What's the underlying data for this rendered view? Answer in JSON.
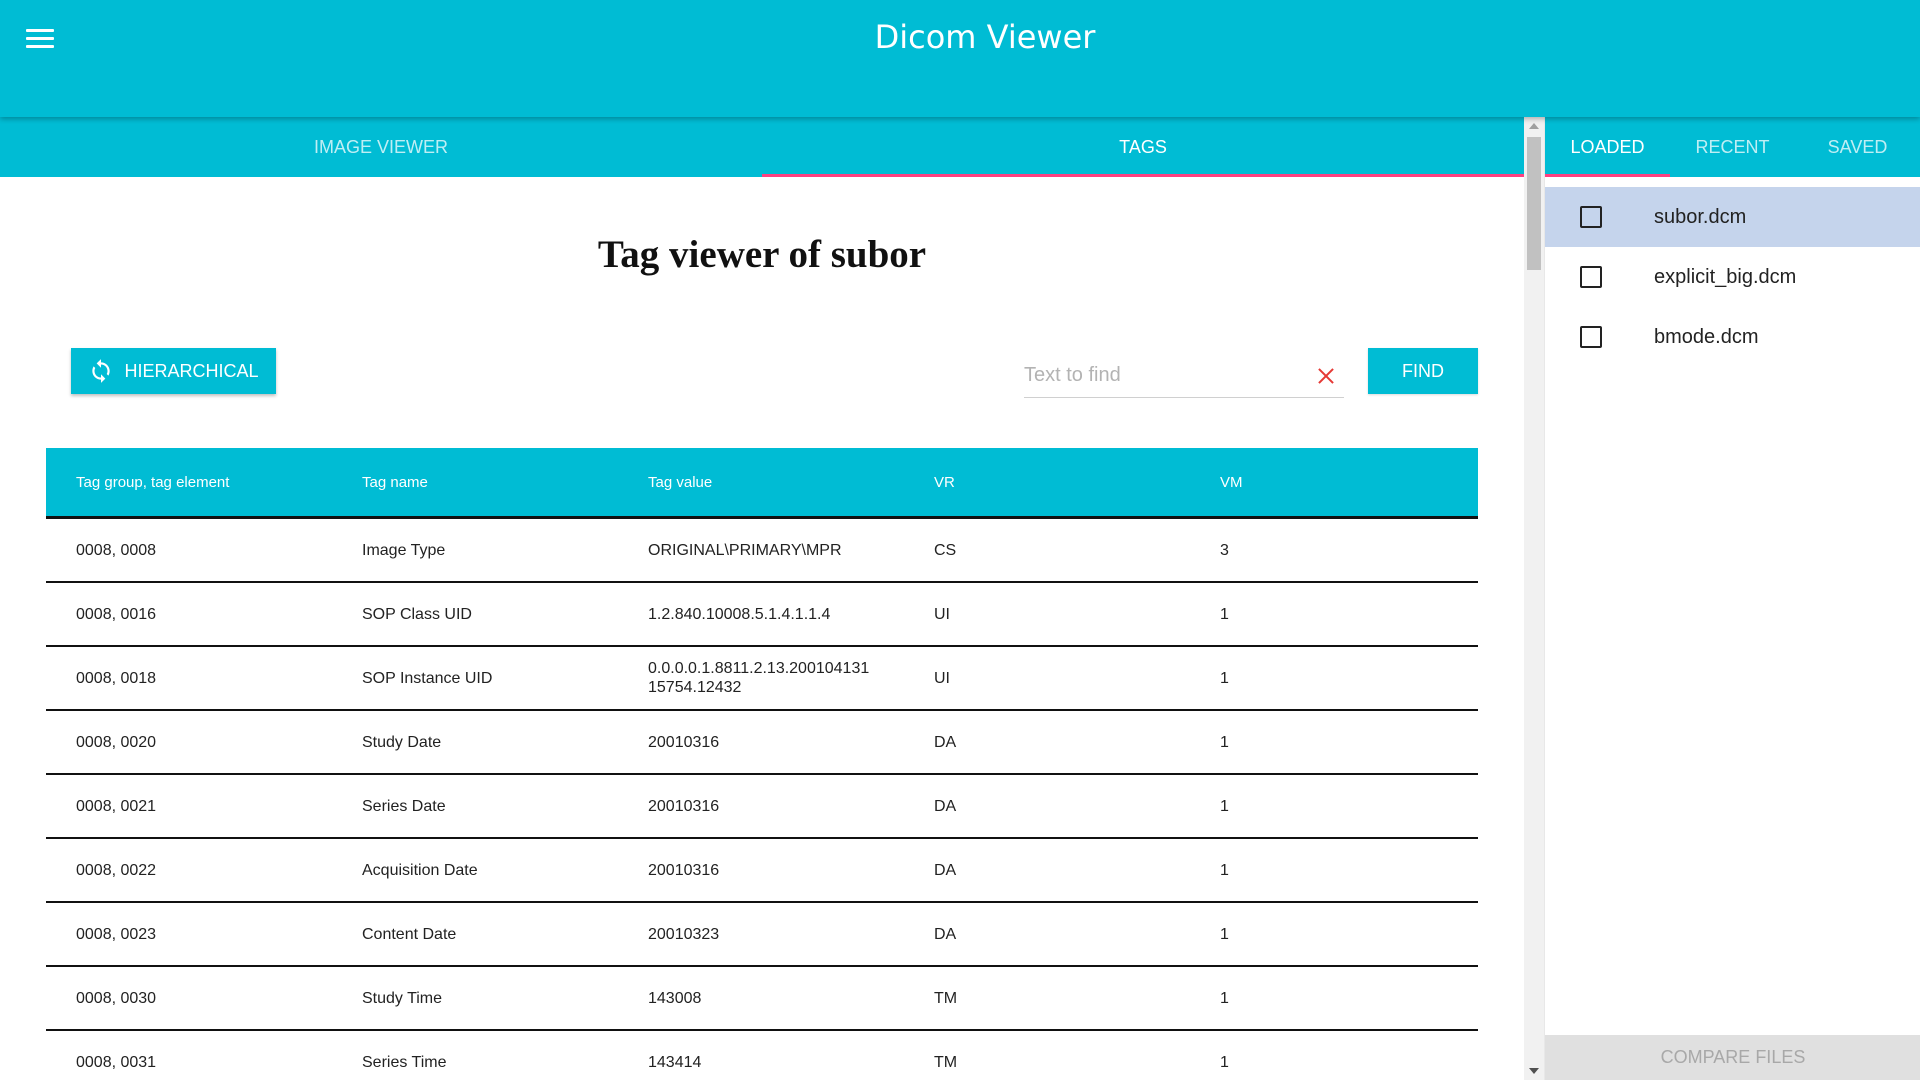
{
  "header": {
    "title": "Dicom Viewer"
  },
  "main_tabs": [
    {
      "label": "IMAGE VIEWER",
      "active": false
    },
    {
      "label": "TAGS",
      "active": true
    }
  ],
  "content": {
    "page_title": "Tag viewer of subor",
    "hierarchical_button": "HIERARCHICAL",
    "search": {
      "placeholder": "Text to find",
      "value": ""
    },
    "find_button": "FIND"
  },
  "table": {
    "headers": [
      "Tag group, tag element",
      "Tag name",
      "Tag value",
      "VR",
      "VM"
    ],
    "rows": [
      [
        "0008, 0008",
        "Image Type",
        "ORIGINAL\\PRIMARY\\MPR",
        "CS",
        "3"
      ],
      [
        "0008, 0016",
        "SOP Class UID",
        "1.2.840.10008.5.1.4.1.1.4",
        "UI",
        "1"
      ],
      [
        "0008, 0018",
        "SOP Instance UID",
        "0.0.0.0.1.8811.2.13.200104131 15754.12432",
        "UI",
        "1"
      ],
      [
        "0008, 0020",
        "Study Date",
        "20010316",
        "DA",
        "1"
      ],
      [
        "0008, 0021",
        "Series Date",
        "20010316",
        "DA",
        "1"
      ],
      [
        "0008, 0022",
        "Acquisition Date",
        "20010316",
        "DA",
        "1"
      ],
      [
        "0008, 0023",
        "Content Date",
        "20010323",
        "DA",
        "1"
      ],
      [
        "0008, 0030",
        "Study Time",
        "143008",
        "TM",
        "1"
      ],
      [
        "0008, 0031",
        "Series Time",
        "143414",
        "TM",
        "1"
      ]
    ]
  },
  "side_panel": {
    "tabs": [
      {
        "label": "LOADED",
        "active": true
      },
      {
        "label": "RECENT",
        "active": false
      },
      {
        "label": "SAVED",
        "active": false
      }
    ],
    "files": [
      {
        "name": "subor.dcm",
        "selected": true,
        "checked": false
      },
      {
        "name": "explicit_big.dcm",
        "selected": false,
        "checked": false
      },
      {
        "name": "bmode.dcm",
        "selected": false,
        "checked": false
      }
    ],
    "compare_button": "COMPARE FILES"
  },
  "colors": {
    "primary": "#00bcd4",
    "accent": "#ff4081",
    "selected_row": "#c5d4ec"
  },
  "icons": {
    "menu": "hamburger-menu-icon",
    "hierarchical": "sync-arrows-icon",
    "clear": "close-x-icon"
  }
}
